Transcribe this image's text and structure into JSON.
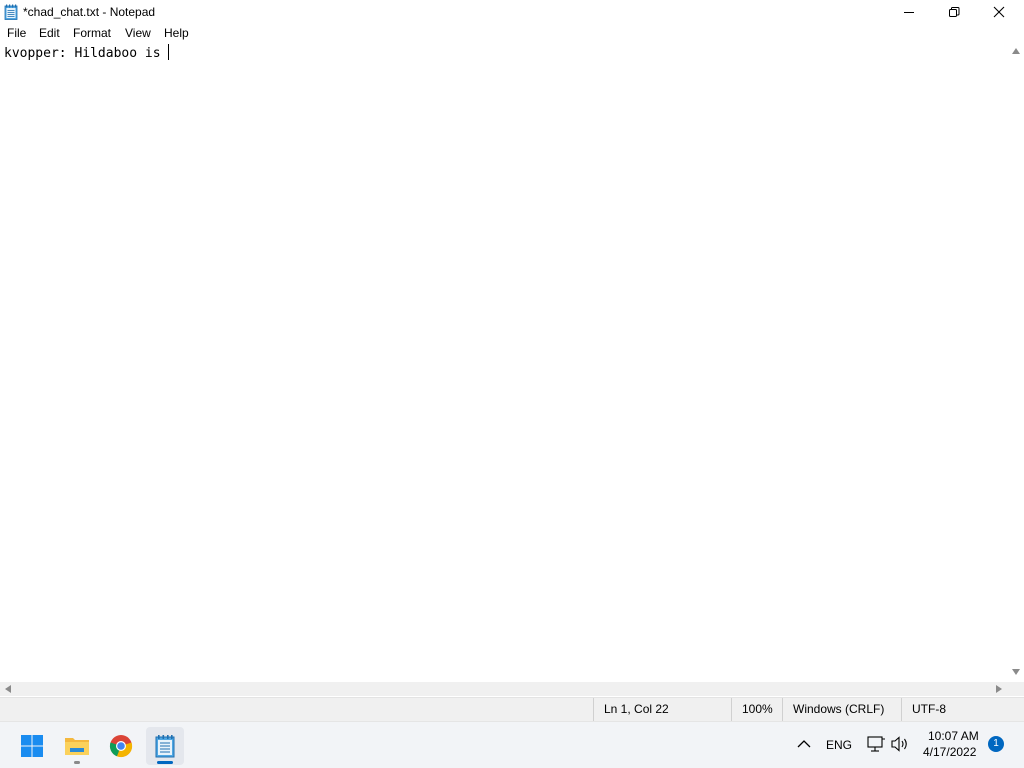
{
  "window": {
    "title": "*chad_chat.txt - Notepad",
    "app_icon": "notepad-icon",
    "controls": [
      "minimize-icon",
      "restore-icon",
      "close-icon"
    ]
  },
  "menu": {
    "items": [
      {
        "label": "File"
      },
      {
        "label": "Edit"
      },
      {
        "label": "Format"
      },
      {
        "label": "View"
      },
      {
        "label": "Help"
      }
    ]
  },
  "editor": {
    "content": "kvopper: Hildaboo is "
  },
  "status": {
    "position": "Ln 1, Col 22",
    "zoom": "100%",
    "line_ending": "Windows (CRLF)",
    "encoding": "UTF-8"
  },
  "taskbar": {
    "apps": [
      {
        "icon": "windows-start-icon"
      },
      {
        "icon": "file-explorer-icon"
      },
      {
        "icon": "chrome-icon"
      },
      {
        "icon": "notepad-icon",
        "active": true
      }
    ],
    "tray": {
      "language": "ENG",
      "time": "10:07 AM",
      "date": "4/17/2022",
      "notification_count": "1"
    }
  },
  "colors": {
    "accent": "#0067c0",
    "statusbar_bg": "#f0f0f0",
    "taskbar_bg": "#f2f4f7"
  }
}
